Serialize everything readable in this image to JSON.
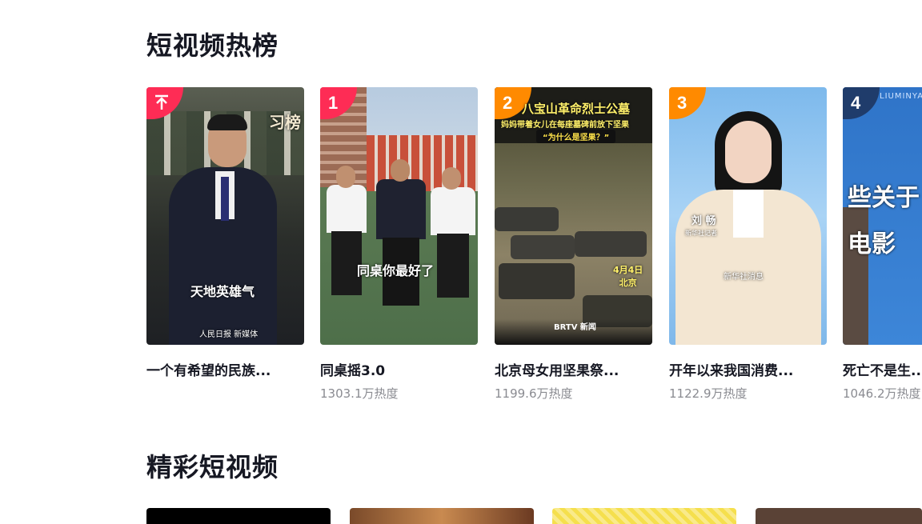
{
  "hot_section": {
    "title": "短视频热榜",
    "cards": [
      {
        "rank": "",
        "title": "一个有希望的民族...",
        "heat": "",
        "overlay": "天地英雄气",
        "watermark": "人民日报 新媒体",
        "corner_text": "习榜"
      },
      {
        "rank": "1",
        "title": "同桌摇3.0",
        "heat": "1303.1万热度",
        "overlay": "同桌你最好了"
      },
      {
        "rank": "2",
        "title": "北京母女用坚果祭...",
        "heat": "1199.6万热度",
        "overlay": "八宝山革命烈士公墓",
        "sub_overlay": "妈妈带着女儿在每座墓碑前放下坚果",
        "bubble": "“为什么是坚果？”",
        "date": "4月4日\n北京",
        "brand": "BRTV 新闻"
      },
      {
        "rank": "3",
        "title": "开年以来我国消费...",
        "heat": "1122.9万热度",
        "name": "刘  畅",
        "name_sub": "新华社记者",
        "caption": "新华社消息"
      },
      {
        "rank": "4",
        "title": "死亡不是生...",
        "heat": "1046.2万热度",
        "overlay": "些关于\n电影",
        "tag": "LIUMINYA"
      }
    ]
  },
  "featured_section": {
    "title": "精彩短视频"
  },
  "colors": {
    "rank_pink": "#fe2c55",
    "rank_orange": "#ff8a00",
    "rank_blue": "#1f3c6b",
    "pin_pink": "#fe2c55"
  }
}
